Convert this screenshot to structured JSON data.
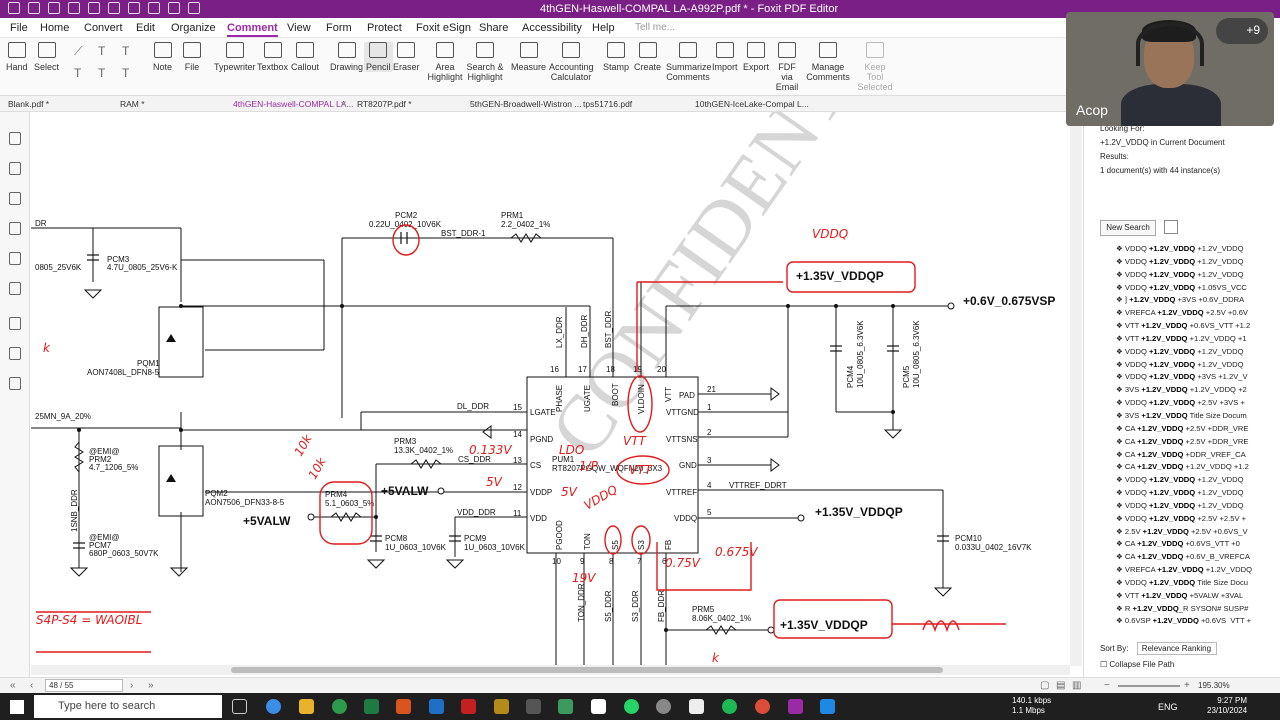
{
  "window": {
    "title": "4thGEN-Haswell-COMPAL LA-A992P.pdf * - Foxit PDF Editor"
  },
  "menu": [
    "File",
    "Home",
    "Convert",
    "Edit",
    "Organize",
    "Comment",
    "View",
    "Form",
    "Protect",
    "Foxit eSign",
    "Share",
    "Accessibility",
    "Help"
  ],
  "menu_active": "Comment",
  "tell_me": "Tell me...",
  "ribbon": {
    "tools": [
      "Hand",
      "Select",
      "Note",
      "File",
      "Typewriter",
      "Textbox",
      "Callout",
      "Drawing",
      "Pencil",
      "Eraser",
      "Area Highlight",
      "Search & Highlight",
      "Measure",
      "Accounting Calculator",
      "Stamp",
      "Create",
      "Summarize Comments",
      "Import",
      "Export",
      "FDF via Email",
      "Manage Comments",
      "Keep Tool Selected"
    ],
    "selected": "Pencil"
  },
  "tabs": [
    "Blank.pdf *",
    "RAM *",
    "4thGEN-Haswell-COMPAL LA...",
    "RT8207P.pdf *",
    "5thGEN-Broadwell-Wistron ...",
    "tps51716.pdf",
    "10thGEN-IceLake-Compal L..."
  ],
  "schematic": {
    "labels": {
      "pcm2": "PCM2",
      "pcm2_val": "0.22U_0402_10V6K",
      "prm1": "PRM1",
      "prm1_val": "2.2_0402_1%",
      "bst": "BST_DDR-1",
      "pcm3": "PCM3",
      "pcm3_val": "4.7U_0805_25V6-K",
      "left_805": "0805_25V6K",
      "ddr": "DR",
      "pqm1": "PQM1",
      "pqm1_val": "AON7408L_DFN8-5",
      "mn": "25MN_9A_20%",
      "prm2a": "@EMI@",
      "prm2": "PRM2",
      "prm2_val": "4.7_1206_5%",
      "snb": "1SNB_DDR",
      "prm7a": "@EMI@",
      "pcm7": "PCM7",
      "pcm7_val": "680P_0603_50V7K",
      "pqm2": "PQM2",
      "pqm2_val": "AON7506_DFN33-8-5",
      "prm3": "PRM3",
      "prm3_val": "13.3K_0402_1%",
      "cs_ddr": "CS_DDR",
      "prm4": "PRM4",
      "prm4_val": "5.1_0603_5%",
      "pcm8": "PCM8",
      "pcm8_val": "1U_0603_10V6K",
      "pcm9": "PCM9",
      "pcm9_val": "1U_0603_10V6K",
      "dl_ddr": "DL_DDR",
      "vdd_ddr": "VDD_DDR",
      "pum1": "PUM1",
      "pum1_val": "RT8207PGQW_WQFN20_3X3",
      "pin_lgate": "LGATE",
      "pin_pgnd": "PGND",
      "pin_cs": "CS",
      "pin_vddp": "VDDP",
      "pin_vdd": "VDD",
      "pin_phase": "PHASE",
      "pin_ugate": "UGATE",
      "pin_boot": "BOOT",
      "pin_vldoin": "VLDOIN",
      "pin_vtt": "VTT",
      "pin_pad": "PAD",
      "pin_vttgnd": "VTTGND",
      "pin_vttsns": "VTTSNS",
      "pin_gnd": "GND",
      "pin_vttref": "VTTREF",
      "pin_vddq": "VDDQ",
      "pin_pgood": "PGOOD",
      "pin_ton": "TON",
      "pin_s5": "S5",
      "pin_s3": "S3",
      "pin_fb": "FB",
      "lx_ddr": "LX_DDR",
      "dh_ddr": "DH_DDR",
      "bst_ddr": "BST_DDR",
      "ton_ddr": "TON_DDR",
      "s5_ddr": "S5_DDR",
      "s3_ddr": "S3_DDR",
      "fb_ddr": "FB_DDR",
      "vttref_ddrt": "VTTREF_DDRT",
      "pcm4": "PCM4",
      "pcm4_val": "10U_0805_6.3V6K",
      "pcm5": "PCM5",
      "pcm5_val": "10U_0805_6.3V6K",
      "pcm10": "PCM10",
      "pcm10_val": "0.033U_0402_16V7K",
      "prm5": "PRM5",
      "prm5_val": "8.06K_0402_1%",
      "rail_vddqp_1": "+1.35V_VDDQP",
      "rail_vddqp_2": "+1.35V_VDDQP",
      "rail_vddqp_3": "+1.35V_VDDQP",
      "rail_vsp": "+0.6V_0.675VSP",
      "rail_5valw_1": "+5VALW",
      "rail_5valw_2": "+5VALW",
      "confidential": "CONFIDENTIAL"
    },
    "pins": [
      "15",
      "14",
      "13",
      "12",
      "11",
      "16",
      "17",
      "18",
      "19",
      "20",
      "21",
      "1",
      "2",
      "3",
      "4",
      "5",
      "10",
      "9",
      "8",
      "7",
      "6"
    ],
    "annotations": {
      "vddq": "VDDQ",
      "vddq_small": "VDDQ",
      "ldo": "LDO",
      "vtt": "VTT",
      "vtt_volt": "0.75V",
      "vtt_volt2": "0.675V",
      "s4": "S4P-S4 = WAOIBL",
      "ohm10k": "10k",
      "ohm10k2": "10k",
      "v5": "5V",
      "v5b": "5V",
      "v19": "19V",
      "i_10": "1/P",
      "dots": "I/P",
      "cs_val": "0.133V",
      "ohm": "k"
    }
  },
  "search_panel": {
    "looking_for_label": "Looking For:",
    "query": "+1.2V_VDDQ in Current Document",
    "results_label": "Results:",
    "summary": "1 document(s) with 44 instance(s)",
    "new_search": "New Search",
    "results": [
      [
        "VDDQ ",
        "+1.2V_VDDQ",
        " +1.2V_VDDQ"
      ],
      [
        "VDDQ ",
        "+1.2V_VDDQ",
        " +1.2V_VDDQ"
      ],
      [
        "VDDQ ",
        "+1.2V_VDDQ",
        " +1.2V_VDDQ"
      ],
      [
        "VDDQ ",
        "+1.2V_VDDQ",
        " +1.05VS_VCC"
      ],
      [
        "] ",
        "+1.2V_VDDQ",
        " +3VS +0.6V_DDRA"
      ],
      [
        "VREFCA ",
        "+1.2V_VDDQ",
        " +2.5V +0.6V"
      ],
      [
        "VTT ",
        "+1.2V_VDDQ",
        " +0.6VS_VTT +1.2"
      ],
      [
        "VTT ",
        "+1.2V_VDDQ",
        " +1.2V_VDDQ +1"
      ],
      [
        "VDDQ ",
        "+1.2V_VDDQ",
        " +1.2V_VDDQ"
      ],
      [
        "VDDQ ",
        "+1.2V_VDDQ",
        " +1.2V_VDDQ"
      ],
      [
        "VDDQ ",
        "+1.2V_VDDQ",
        " +3VS +1.2V_V"
      ],
      [
        "3VS ",
        "+1.2V_VDDQ",
        " +1.2V_VDDQ +2"
      ],
      [
        "VDDQ ",
        "+1.2V_VDDQ",
        " +2.5V +3VS +"
      ],
      [
        "3VS ",
        "+1.2V_VDDQ",
        " Title Size Docum"
      ],
      [
        "CA ",
        "+1.2V_VDDQ",
        " +2.5V +DDR_VRE"
      ],
      [
        "CA ",
        "+1.2V_VDDQ",
        " +2.5V +DDR_VRE"
      ],
      [
        "CA ",
        "+1.2V_VDDQ",
        " +DDR_VREF_CA"
      ],
      [
        "CA ",
        "+1.2V_VDDQ",
        " +1.2V_VDDQ +1.2"
      ],
      [
        "VDDQ ",
        "+1.2V_VDDQ",
        " +1.2V_VDDQ"
      ],
      [
        "VDDQ ",
        "+1.2V_VDDQ",
        " +1.2V_VDDQ"
      ],
      [
        "VDDQ ",
        "+1.2V_VDDQ",
        " +1.2V_VDDQ"
      ],
      [
        "VDDQ ",
        "+1.2V_VDDQ",
        " +2.5V +2.5V +"
      ],
      [
        "2.5V ",
        "+1.2V_VDDQ",
        " +2.5V +0.6VS_V"
      ],
      [
        "CA ",
        "+1.2V_VDDQ",
        " +0.6VS_VTT +0"
      ],
      [
        "CA ",
        "+1.2V_VDDQ",
        " +0.6V_B_VREFCA"
      ],
      [
        "VREFCA ",
        "+1.2V_VDDQ",
        " +1.2V_VDDQ"
      ],
      [
        "VDDQ ",
        "+1.2V_VDDQ",
        " Title Size Docu"
      ],
      [
        "VTT ",
        "+1.2V_VDDQ",
        " +5VALW +3VAL"
      ],
      [
        "R ",
        "+1.2V_VDDQ",
        "_R SYSON# SUSP#"
      ],
      [
        "0.6VSP ",
        "+1.2V_VDDQ",
        " +0.6VS_VTT +"
      ]
    ],
    "sort_by_label": "Sort By:",
    "sort_value": "Relevance Ranking",
    "collapse": "Collapse File Path"
  },
  "webcam": {
    "name": "Acop",
    "badge": "+9"
  },
  "statusbar": {
    "page": "48 / 55",
    "zoom": "195.30%"
  },
  "taskbar": {
    "search_placeholder": "Type here to search",
    "net_down": "140.1 kbps",
    "net_up": "1.1 Mbps",
    "lang": "ENG",
    "time": "9:27 PM",
    "date": "23/10/2024"
  },
  "colors": {
    "accent": "#9b2aa6",
    "titlebar": "#7a1f86",
    "ink": "#e01b1b"
  }
}
